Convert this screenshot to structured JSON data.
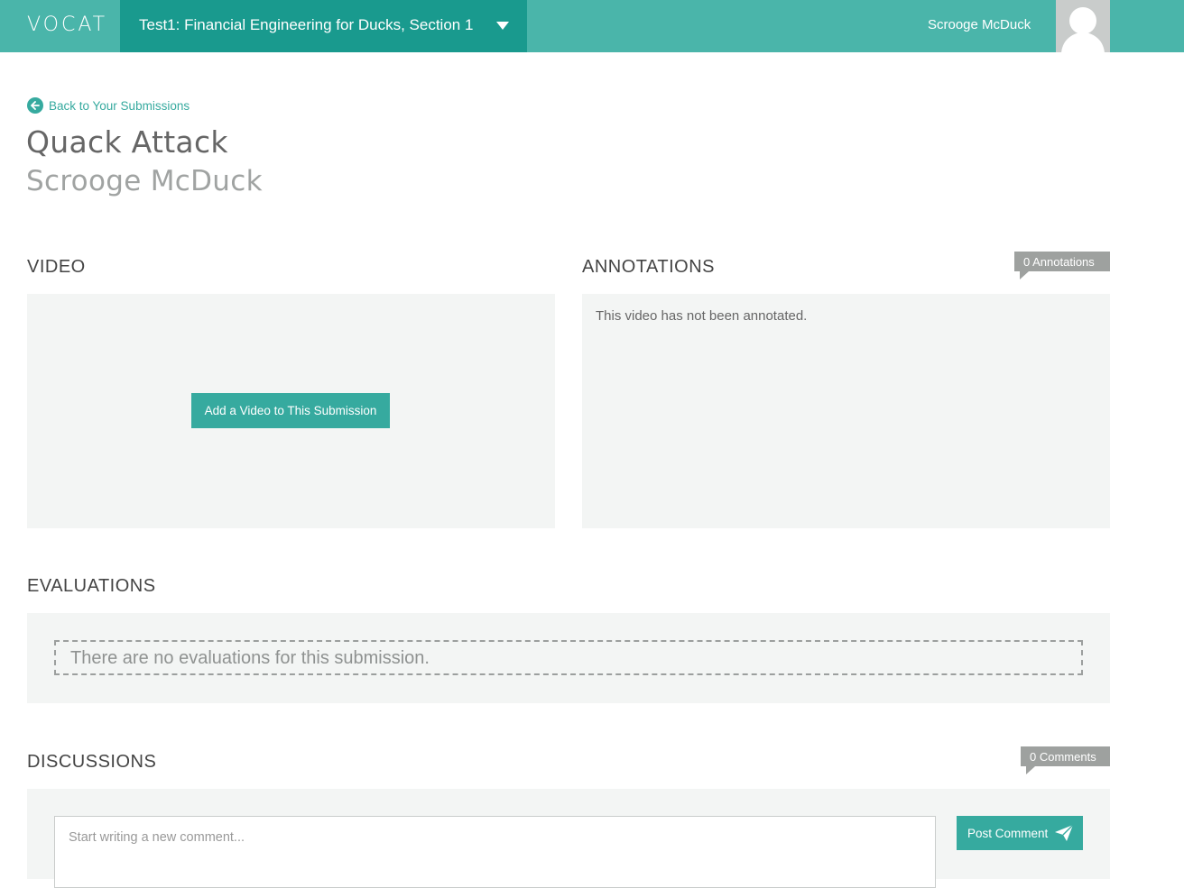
{
  "header": {
    "logo": "VOCAT",
    "course": "Test1: Financial Engineering for Ducks, Section 1",
    "user_name": "Scrooge McDuck"
  },
  "page": {
    "back_link": "Back to Your Submissions",
    "title": "Quack Attack",
    "subtitle": "Scrooge McDuck"
  },
  "video": {
    "heading": "VIDEO",
    "add_button": "Add a Video to This Submission"
  },
  "annotations": {
    "heading": "ANNOTATIONS",
    "count_label": "0 Annotations",
    "empty_text": "This video has not been annotated."
  },
  "evaluations": {
    "heading": "EVALUATIONS",
    "empty_text": "There are no evaluations for this submission."
  },
  "discussions": {
    "heading": "DISCUSSIONS",
    "count_label": "0 Comments",
    "comment_placeholder": "Start writing a new comment...",
    "post_button": "Post Comment"
  },
  "colors": {
    "header_bg": "#4ab5aa",
    "course_select_bg": "#199a8e",
    "accent": "#36aa9f",
    "panel_bg": "#f3f5f4",
    "badge_bg": "#9ea19f"
  }
}
